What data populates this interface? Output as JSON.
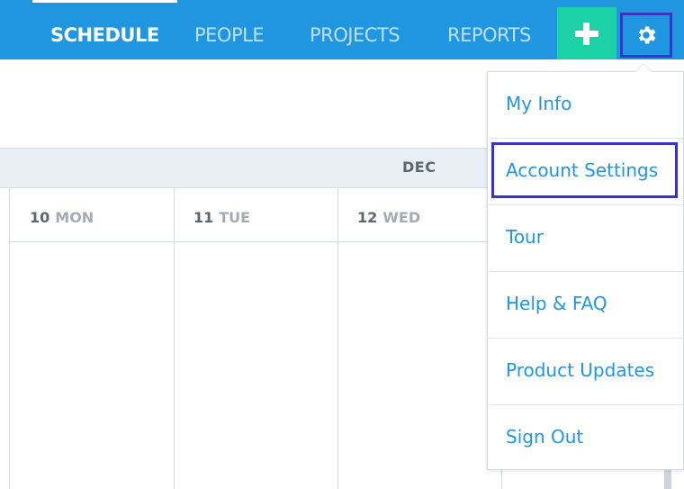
{
  "nav": {
    "items": [
      {
        "label": "SCHEDULE",
        "active": true
      },
      {
        "label": "PEOPLE",
        "active": false
      },
      {
        "label": "PROJECTS",
        "active": false
      },
      {
        "label": "REPORTS",
        "active": false
      }
    ],
    "add_icon": "plus-icon",
    "settings_icon": "gear-icon"
  },
  "calendar": {
    "month": "DEC",
    "days": [
      {
        "num": "10",
        "name": "MON"
      },
      {
        "num": "11",
        "name": "TUE"
      },
      {
        "num": "12",
        "name": "WED"
      }
    ]
  },
  "menu": {
    "items": [
      {
        "label": "My Info"
      },
      {
        "label": "Account Settings"
      },
      {
        "label": "Tour"
      },
      {
        "label": "Help & FAQ"
      },
      {
        "label": "Product Updates"
      },
      {
        "label": "Sign Out"
      }
    ]
  },
  "colors": {
    "nav_bg": "#2196e0",
    "add_button": "#1bd1a5",
    "highlight": "#3a33c9",
    "link": "#2196e0"
  }
}
